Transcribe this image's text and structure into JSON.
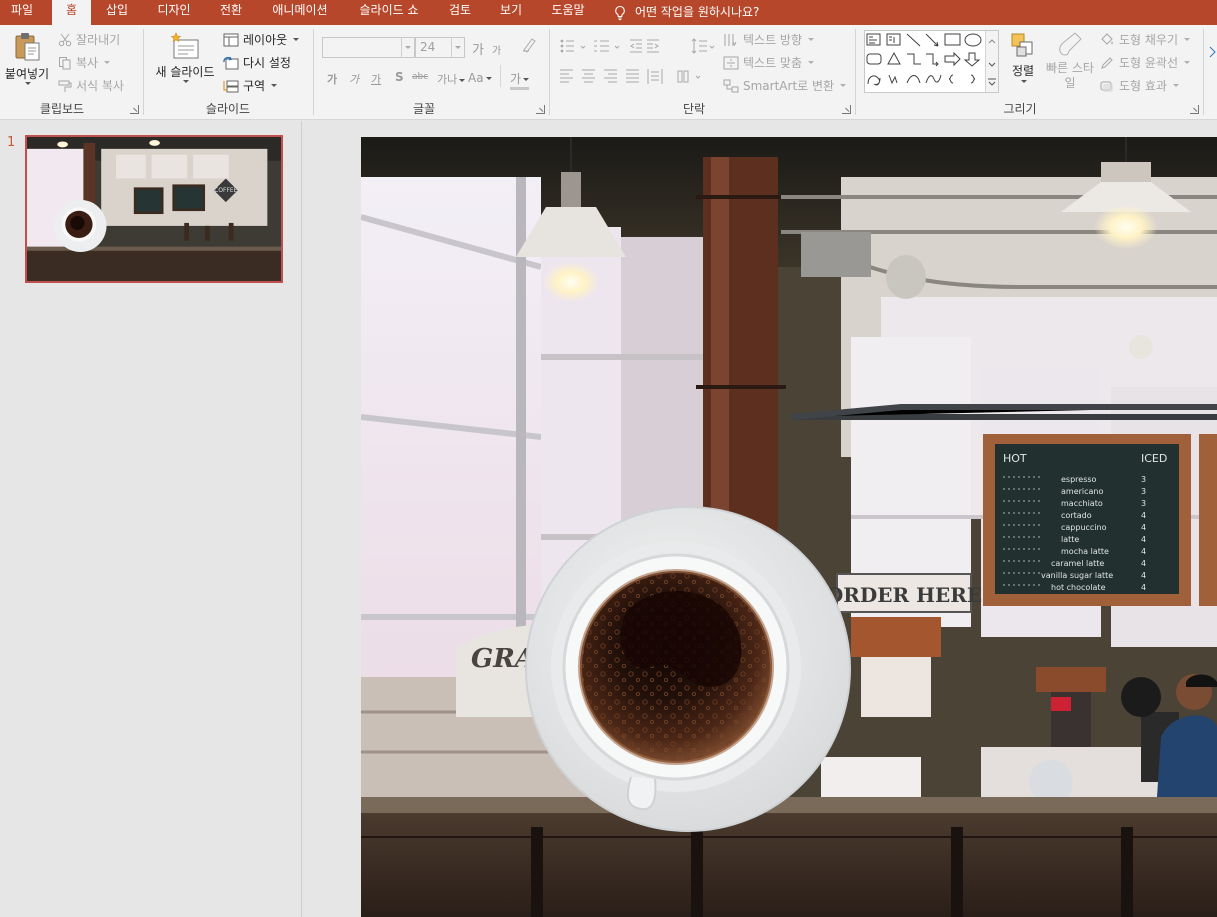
{
  "tabs": [
    {
      "label": "파일",
      "active": false
    },
    {
      "label": "홈",
      "active": true
    },
    {
      "label": "삽입",
      "active": false
    },
    {
      "label": "디자인",
      "active": false
    },
    {
      "label": "전환",
      "active": false
    },
    {
      "label": "애니메이션",
      "active": false
    },
    {
      "label": "슬라이드 쇼",
      "active": false
    },
    {
      "label": "검토",
      "active": false
    },
    {
      "label": "보기",
      "active": false
    },
    {
      "label": "도움말",
      "active": false
    }
  ],
  "tell_me": {
    "icon": "lightbulb-icon",
    "text": "어떤 작업을 원하시나요?"
  },
  "clipboard": {
    "group_label": "클립보드",
    "paste": "붙여넣기",
    "cut": "잘라내기",
    "copy": "복사",
    "format_painter": "서식 복사"
  },
  "slides_group": {
    "group_label": "슬라이드",
    "new_slide": "새 슬라이드",
    "layout": "레이아웃",
    "reset": "다시 설정",
    "section": "구역"
  },
  "font_group": {
    "group_label": "글꼴",
    "font_name": "",
    "font_size": "24",
    "grow": "가",
    "shrink": "가",
    "bold": "가",
    "italic": "가",
    "underline": "가",
    "shadow": "S",
    "strike": "abc",
    "spacing": "가나",
    "case": "Aa",
    "color": "가"
  },
  "paragraph_group": {
    "group_label": "단락",
    "text_direction": "텍스트 방향",
    "align_text": "텍스트 맞춤",
    "smartart": "SmartArt로 변환"
  },
  "drawing_group": {
    "group_label": "그리기",
    "arrange": "정렬",
    "quick_styles": "빠른 스타일",
    "shape_fill": "도형 채우기",
    "shape_outline": "도형 윤곽선",
    "shape_effects": "도형 효과"
  },
  "thumbnails": [
    {
      "number": "1",
      "selected": true
    }
  ],
  "slide": {
    "menu_board": {
      "hot": "HOT",
      "iced": "ICED",
      "items": [
        "espresso",
        "americano",
        "macchiato",
        "cortado",
        "cappuccino",
        "latte",
        "mocha latte",
        "caramel latte",
        "vanilla sugar latte",
        "hot chocolate"
      ],
      "prices": [
        "3",
        "3",
        "3",
        "4",
        "4",
        "4",
        "4",
        "4",
        "4",
        "4"
      ]
    },
    "sign": "ORDER HERE",
    "crate_text": "GRA",
    "thumb_sign": "COFFEE"
  },
  "colors": {
    "accent": "#b7472a",
    "ribbon_bg": "#f3f3f3",
    "pane_bg": "#e6e6e6"
  }
}
